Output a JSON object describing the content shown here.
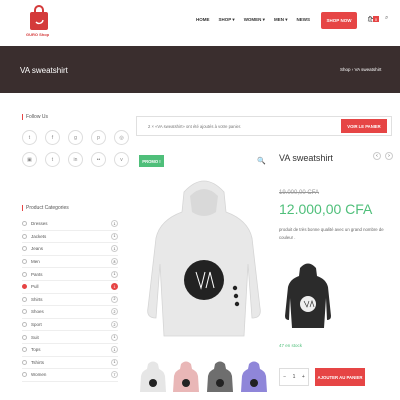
{
  "header": {
    "logo_text": "GURO Shop",
    "nav": [
      {
        "label": "HOME"
      },
      {
        "label": "SHOP ▾"
      },
      {
        "label": "WOMEN ▾"
      },
      {
        "label": "MEN ▾"
      },
      {
        "label": "NEWS"
      }
    ],
    "shop_now": "SHOP NOW",
    "cart_count": "0"
  },
  "banner": {
    "title": "VA sweatshirt",
    "breadcrumb": "Shop › VA sweatshirt"
  },
  "sidebar": {
    "follow_title": "Follow Us",
    "social": [
      {
        "icon": "twitter-icon",
        "glyph": "t"
      },
      {
        "icon": "facebook-icon",
        "glyph": "f"
      },
      {
        "icon": "google-plus-icon",
        "glyph": "g"
      },
      {
        "icon": "pinterest-icon",
        "glyph": "p"
      },
      {
        "icon": "dribbble-icon",
        "glyph": "◎"
      },
      {
        "icon": "instagram-icon",
        "glyph": "▣"
      },
      {
        "icon": "tumblr-icon",
        "glyph": "t"
      },
      {
        "icon": "linkedin-icon",
        "glyph": "in"
      },
      {
        "icon": "flickr-icon",
        "glyph": "••"
      },
      {
        "icon": "vimeo-icon",
        "glyph": "v"
      }
    ],
    "categories_title": "Product Categories",
    "categories": [
      {
        "label": "Dresses",
        "count": "1"
      },
      {
        "label": "Jackets",
        "count": "1"
      },
      {
        "label": "Jeans",
        "count": "1"
      },
      {
        "label": "Men",
        "count": "8"
      },
      {
        "label": "Pants",
        "count": "1"
      },
      {
        "label": "Pull",
        "count": "1",
        "active": true
      },
      {
        "label": "Shirts",
        "count": "2"
      },
      {
        "label": "Shoes",
        "count": "2"
      },
      {
        "label": "Sport",
        "count": "2"
      },
      {
        "label": "Suit",
        "count": "1"
      },
      {
        "label": "Tops",
        "count": "1"
      },
      {
        "label": "Tshirts",
        "count": "1"
      },
      {
        "label": "Women",
        "count": "7"
      }
    ]
  },
  "notice": {
    "text": "2 × «VA sweatshirt» ont été ajoutés à votre panier.",
    "button": "VOIR LE PANIER"
  },
  "product": {
    "badge": "PROMO !",
    "title": "VA sweatshirt",
    "old_price": "19.000,00 CFA",
    "new_price": "12.000,00 CFA",
    "description": "produit de très bonne qualité avec un grand nombre de couleur .",
    "stock": "47 en stock",
    "qty": "1",
    "add_to_cart": "AJOUTER AU PANIER",
    "thumb_colors": [
      "#e6e6e6",
      "#e9b7b7",
      "#6e6e6e",
      "#8f86d9"
    ]
  }
}
